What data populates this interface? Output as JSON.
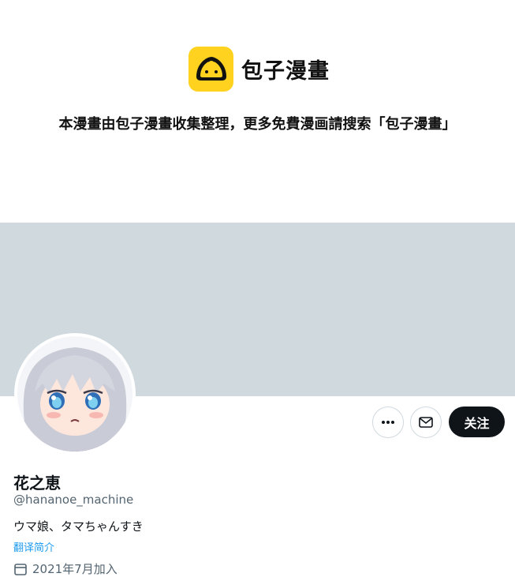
{
  "watermark": {
    "brand_name": "包子漫畫",
    "notice": "本漫畫由包子漫畫收集整理，更多免費漫画請搜索「包子漫畫」"
  },
  "profile": {
    "display_name": "花之恵",
    "handle": "@hananoe_machine",
    "bio": "ウマ娘、タマちゃんすき",
    "translate_link": "翻译简介",
    "joined_text": "2021年7月加入"
  },
  "actions": {
    "follow_label": "关注"
  },
  "icons": {
    "more": "more-icon",
    "message": "mail-icon",
    "calendar": "calendar-icon",
    "logo": "steamed-bun-logo-icon"
  },
  "colors": {
    "banner": "#cfd9de",
    "logo_yellow": "#ffd21f",
    "follow_bg": "#0f1419",
    "link": "#1d9bf0",
    "secondary_text": "#536471"
  }
}
